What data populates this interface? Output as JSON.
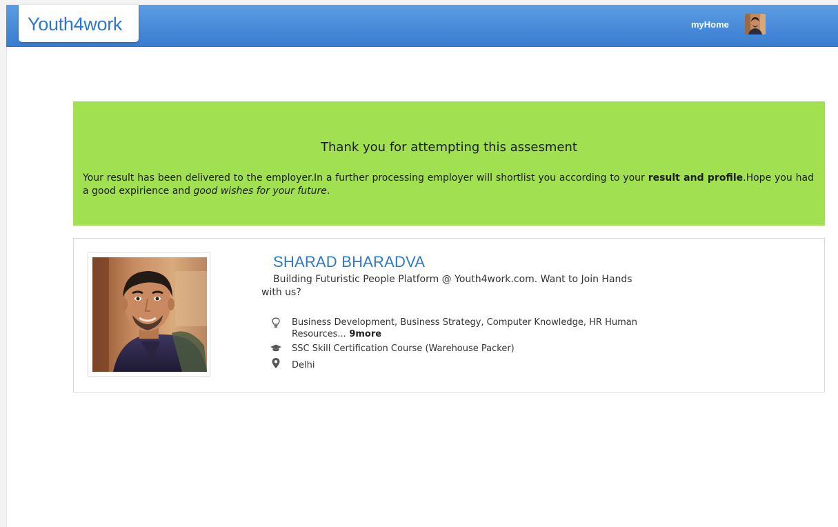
{
  "header": {
    "logo_text": "Youth4work",
    "myhome_label": "myHome",
    "brand_color": "#3a7dd0",
    "avatar_icon": "user-avatar"
  },
  "banner": {
    "title": "Thank you for attempting this assesment",
    "message_part1": "Your result has been delivered to the employer.In a further processing employer will shortlist you according to your ",
    "message_bold": "result and profile",
    "message_part2": ".Hope you had a good expirience and ",
    "message_italic": "good wishes for your future",
    "message_end": ".",
    "background_color": "#a1e051"
  },
  "profile": {
    "name": "SHARAD BHARADVA",
    "tagline": "Building Futuristic People Platform @ Youth4work.com. Want to Join Hands with us?",
    "skills_text": "Business Development, Business Strategy, Computer Knowledge, HR Human Resources...",
    "skills_more": " 9more",
    "skills_icon": "lightbulb-icon",
    "education": "SSC Skill Certification Course (Warehouse Packer)",
    "education_icon": "graduation-cap-icon",
    "location": "Delhi",
    "location_icon": "map-pin-icon",
    "name_color": "#2f77c8"
  }
}
